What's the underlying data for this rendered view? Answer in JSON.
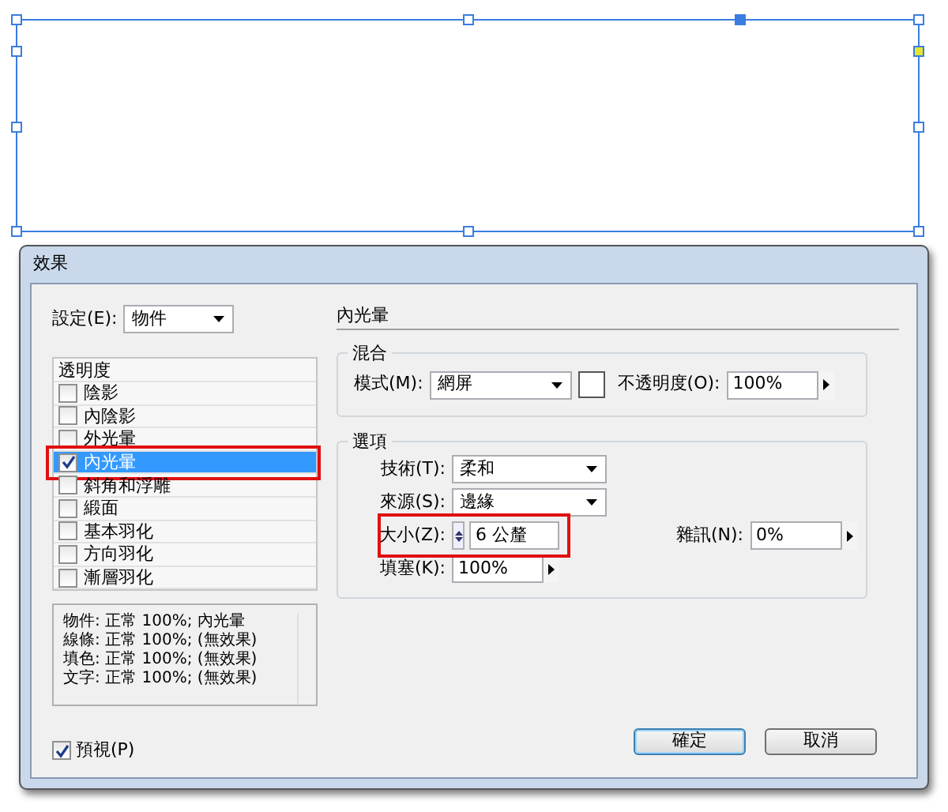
{
  "dialog": {
    "title": "效果",
    "settings": {
      "label": "設定(E):",
      "value": "物件"
    },
    "effects_list": {
      "header": "透明度",
      "items": [
        {
          "label": "陰影",
          "checked": false,
          "selected": false,
          "highlighted": false
        },
        {
          "label": "內陰影",
          "checked": false,
          "selected": false,
          "highlighted": false
        },
        {
          "label": "外光暈",
          "checked": false,
          "selected": false,
          "highlighted": false
        },
        {
          "label": "內光暈",
          "checked": true,
          "selected": true,
          "highlighted": true
        },
        {
          "label": "斜角和浮雕",
          "checked": false,
          "selected": false,
          "highlighted": false
        },
        {
          "label": "緞面",
          "checked": false,
          "selected": false,
          "highlighted": false
        },
        {
          "label": "基本羽化",
          "checked": false,
          "selected": false,
          "highlighted": false
        },
        {
          "label": "方向羽化",
          "checked": false,
          "selected": false,
          "highlighted": false
        },
        {
          "label": "漸層羽化",
          "checked": false,
          "selected": false,
          "highlighted": false
        }
      ]
    },
    "summary": [
      "物件: 正常 100%; 內光暈",
      "線條: 正常 100%; (無效果)",
      "填色: 正常 100%; (無效果)",
      "文字: 正常 100%; (無效果)"
    ],
    "preview": {
      "label": "預視(P)",
      "checked": true
    },
    "panel_title": "內光暈",
    "blend": {
      "title": "混合",
      "mode": {
        "label": "模式(M):",
        "value": "網屏"
      },
      "opacity": {
        "label": "不透明度(O):",
        "value": "100%"
      }
    },
    "options": {
      "title": "選項",
      "technique": {
        "label": "技術(T):",
        "value": "柔和"
      },
      "source": {
        "label": "來源(S):",
        "value": "邊緣"
      },
      "size": {
        "label": "大小(Z):",
        "value": "6 公釐",
        "highlighted": true
      },
      "noise": {
        "label": "雜訊(N):",
        "value": "0%"
      },
      "choke": {
        "label": "填塞(K):",
        "value": "100%"
      }
    },
    "buttons": [
      {
        "label": "確定",
        "default": true
      },
      {
        "label": "取消",
        "default": false
      }
    ]
  }
}
